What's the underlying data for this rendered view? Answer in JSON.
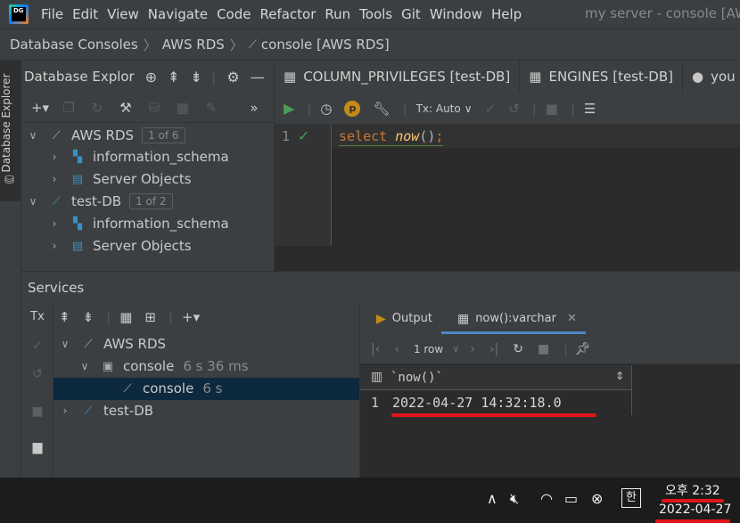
{
  "menubar": {
    "logo": "DG",
    "items": [
      "File",
      "Edit",
      "View",
      "Navigate",
      "Code",
      "Refactor",
      "Run",
      "Tools",
      "Git",
      "Window",
      "Help"
    ],
    "window_title": "my server - console [AWS"
  },
  "breadcrumb": {
    "items": [
      "Database Consoles",
      "AWS RDS",
      "console [AWS RDS]"
    ]
  },
  "left_strip": {
    "label": "Database Explorer"
  },
  "explorer": {
    "title": "Database Explor",
    "tree": {
      "aws_rds": {
        "label": "AWS RDS",
        "badge": "1 of 6"
      },
      "aws_info_schema": {
        "label": "information_schema"
      },
      "aws_server_objects": {
        "label": "Server Objects"
      },
      "test_db": {
        "label": "test-DB",
        "badge": "1 of 2"
      },
      "test_info_schema": {
        "label": "information_schema"
      },
      "test_server_objects": {
        "label": "Server Objects"
      }
    }
  },
  "editor_tabs": {
    "tab1": "COLUMN_PRIVILEGES [test-DB]",
    "tab2": "ENGINES [test-DB]",
    "tab3": "you"
  },
  "editor_toolbar": {
    "tx_mode": "Tx: Auto"
  },
  "editor": {
    "line_number": "1",
    "code_keyword": "select",
    "code_function": "now",
    "code_parens": "()",
    "code_semicolon": ";"
  },
  "services": {
    "title": "Services",
    "tx_label": "Tx",
    "tree": {
      "aws_rds": {
        "label": "AWS RDS"
      },
      "console_session": {
        "label": "console",
        "meta": "6 s 36 ms"
      },
      "console_leaf": {
        "label": "console",
        "meta": "6 s"
      },
      "test_db": {
        "label": "test-DB"
      }
    }
  },
  "results": {
    "tabs": {
      "output": "Output",
      "result": "now():varchar"
    },
    "row_count_label": "1 row",
    "column_header": "`now()`",
    "row_index": "1",
    "cell_value": "2022-04-27 14:32:18.0"
  },
  "taskbar": {
    "ime_label": "한",
    "time": "오후 2:32",
    "date": "2022-04-27"
  },
  "colors": {
    "accent": "#4a88c7",
    "keyword": "#cc7832",
    "function": "#ffc66d",
    "success": "#499c54",
    "highlight_mark": "#e0141a"
  }
}
